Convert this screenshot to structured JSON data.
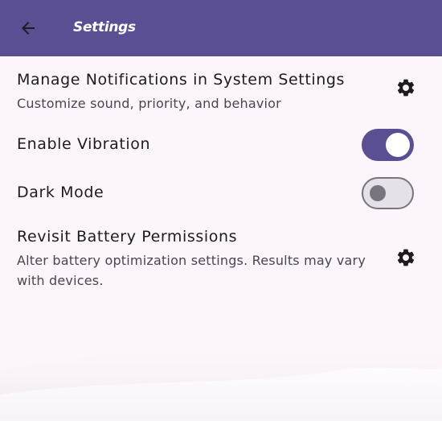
{
  "app_bar": {
    "title": "Settings",
    "back_icon": "arrow-left-icon",
    "background": "#5b4f94"
  },
  "settings": {
    "notifications": {
      "title": "Manage Notifications in System Settings",
      "subtitle": "Customize sound, priority, and behavior",
      "icon": "gear-icon"
    },
    "vibration": {
      "title": "Enable Vibration",
      "enabled": true
    },
    "dark_mode": {
      "title": "Dark Mode",
      "enabled": false
    },
    "battery": {
      "title": "Revisit Battery Permissions",
      "subtitle_line1": "Alter battery optimization settings. Results may vary",
      "subtitle_line2": "with devices.",
      "icon": "gear-icon"
    }
  },
  "colors": {
    "accent": "#5b4f94",
    "background": "#fcf5fc",
    "text": "#1e1b20",
    "subtext": "#4a4650"
  }
}
